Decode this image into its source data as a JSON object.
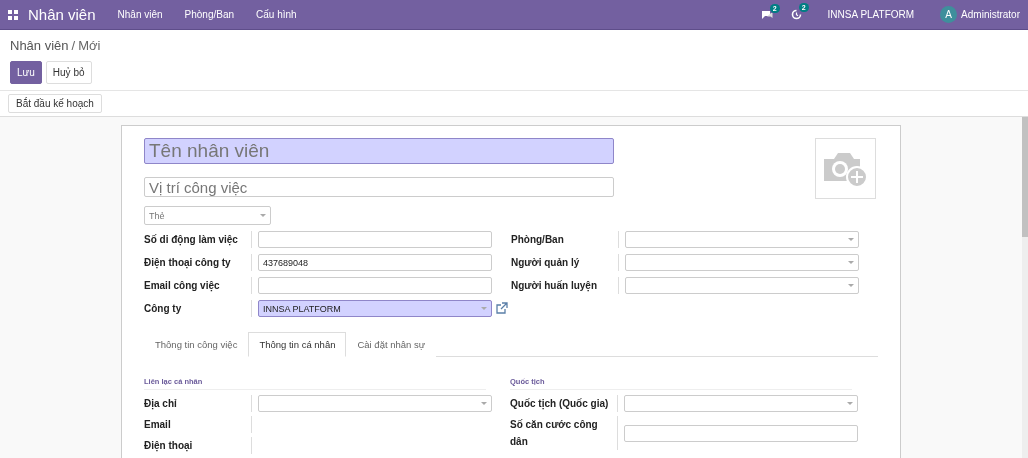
{
  "navbar": {
    "app_name": "Nhân viên",
    "menus": [
      "Nhân viên",
      "Phòng/Ban",
      "Cấu hình"
    ],
    "chat_badge": "2",
    "activity_badge": "2",
    "company": "INNSA PLATFORM",
    "user": {
      "initial": "A",
      "name": "Administrator"
    }
  },
  "breadcrumb": {
    "parent": "Nhân viên",
    "separator": "/",
    "current": "Mới"
  },
  "buttons": [
    {
      "label": "Lưu",
      "kind": "primary"
    },
    {
      "label": "Huỷ bỏ",
      "kind": "secondary"
    }
  ],
  "status_buttons": [
    "Bắt đầu kế hoạch"
  ],
  "form": {
    "name_field": {
      "placeholder": "Tên nhân viên",
      "required": true
    },
    "job_field": {
      "placeholder": "Vị trí công việc"
    },
    "tags_field": {
      "placeholder": "Thẻ"
    },
    "left_fields": [
      {
        "label": "Số di động làm việc",
        "kind": "text",
        "required": false,
        "external_link": false
      },
      {
        "label": "Điện thoại công ty",
        "kind": "text",
        "value": "437689048",
        "required": false,
        "external_link": false
      },
      {
        "label": "Email công việc",
        "kind": "text",
        "required": false,
        "external_link": false
      },
      {
        "label": "Công ty",
        "kind": "select",
        "value": "INNSA PLATFORM",
        "required": true,
        "external_link": true
      }
    ],
    "right_fields": [
      {
        "label": "Phòng/Ban",
        "kind": "select",
        "required": false,
        "external_link": false
      },
      {
        "label": "Người quản lý",
        "kind": "select",
        "required": false,
        "external_link": false
      },
      {
        "label": "Người huấn luyện",
        "kind": "select",
        "required": false,
        "external_link": false
      }
    ],
    "tabs": [
      {
        "label": "Thông tin công việc",
        "selected": false
      },
      {
        "label": "Thông tin cá nhân",
        "selected": true
      },
      {
        "label": "Cài đặt nhân sự",
        "selected": false
      }
    ],
    "sections": [
      {
        "title": "Liên lạc cá nhân",
        "fields": [
          {
            "label": "Địa chỉ",
            "kind": "select"
          },
          {
            "label": "Email",
            "kind": "none"
          },
          {
            "label": "Điện thoại",
            "kind": "none"
          }
        ]
      },
      {
        "title": "Quốc tịch",
        "fields": [
          {
            "label": "Quốc tịch (Quốc gia)",
            "kind": "select"
          },
          {
            "label": "Số căn cước công dân",
            "kind": "text"
          }
        ]
      }
    ]
  }
}
